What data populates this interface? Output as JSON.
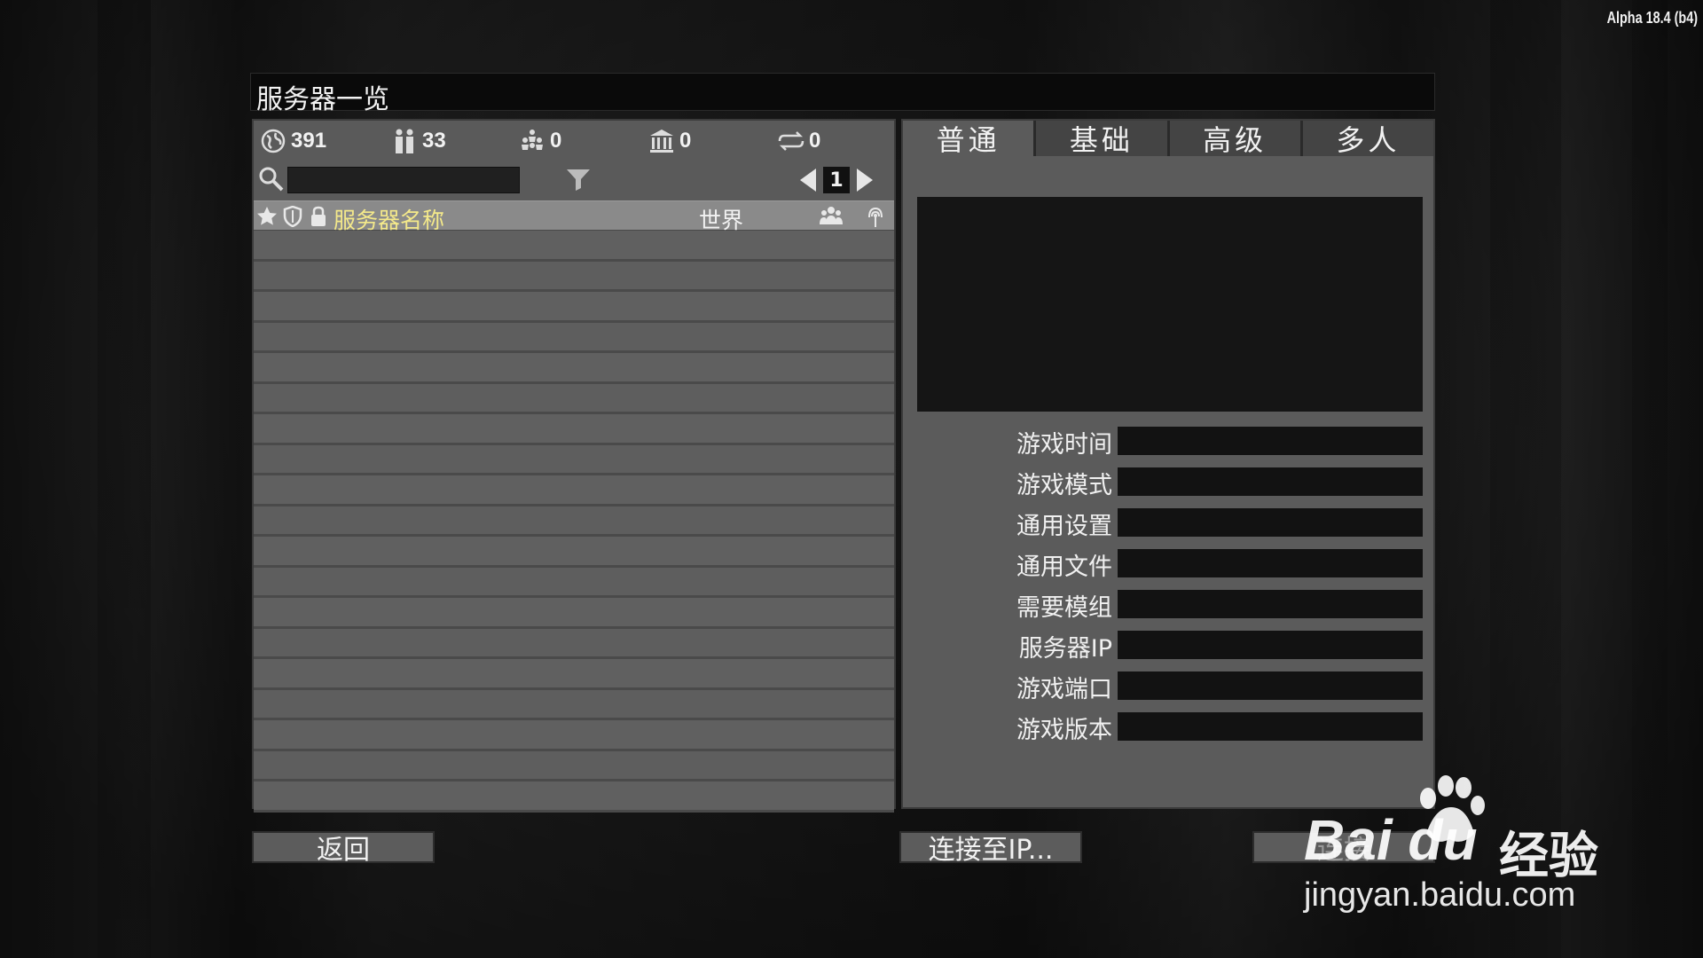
{
  "version": "Alpha 18.4 (b4)",
  "window": {
    "title": "服务器一览"
  },
  "stats": [
    {
      "icon": "globe-icon",
      "value": "391"
    },
    {
      "icon": "players-icon",
      "value": "33"
    },
    {
      "icon": "group-icon",
      "value": "0"
    },
    {
      "icon": "bank-icon",
      "value": "0"
    },
    {
      "icon": "transfer-icon",
      "value": "0"
    }
  ],
  "search": {
    "value": "",
    "placeholder": ""
  },
  "pager": {
    "page": "1"
  },
  "list": {
    "columns": {
      "name": "服务器名称",
      "world": "世界"
    },
    "row_count": 19
  },
  "tabs": [
    "普通",
    "基础",
    "高级",
    "多人"
  ],
  "info": {
    "labels": [
      "游戏时间",
      "游戏模式",
      "通用设置",
      "通用文件",
      "需要模组",
      "服务器IP",
      "游戏端口",
      "游戏版本"
    ]
  },
  "buttons": {
    "back": "返回",
    "connect_ip": "连接至IP...",
    "connect": "连接"
  },
  "watermark": {
    "brand": "Bai du",
    "text": "经验",
    "url": "jingyan.baidu.com"
  },
  "colors": {
    "header_name": "#f4e98a",
    "panel": "#5b5b5b",
    "title_bar": "#0a0a0a"
  }
}
